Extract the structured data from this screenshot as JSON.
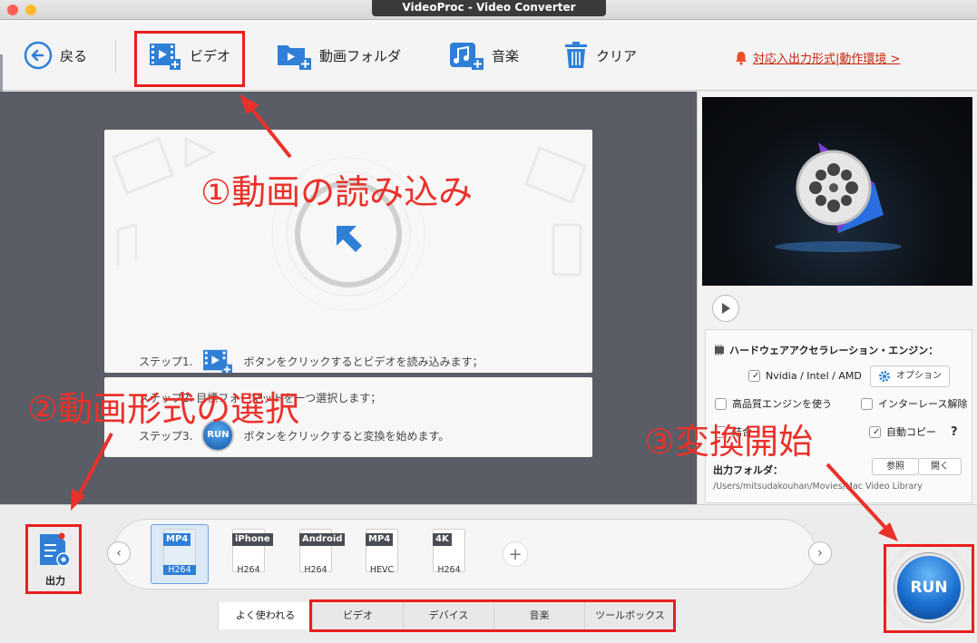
{
  "window": {
    "title": "VideoProc - Video Converter"
  },
  "toolbar": {
    "back_label": "戻る",
    "video_label": "ビデオ",
    "folder_label": "動画フォルダ",
    "music_label": "音楽",
    "clear_label": "クリア",
    "notice_link": "対応入出力形式|動作環境 >"
  },
  "steps": {
    "step1_prefix": "ステップ1.",
    "step1_text": "ボタンをクリックするとビデオを読み込みます；",
    "step2_text": "ステップ2. 目標フォーマットを一つ選択します；",
    "step3_prefix": "ステップ3.",
    "step3_text": "ボタンをクリックすると変換を始めます。",
    "run_small": "RUN"
  },
  "settings": {
    "hw_title": "ハードウェアアクセラレーション・エンジン：",
    "nvidia_label": "Nvidia /  Intel / AMD",
    "option_label": "オプション",
    "hq_engine_label": "高品質エンジンを使う",
    "deinterlace_label": "インターレース解除",
    "merge_label": "結合",
    "autocopy_label": "自動コピー",
    "help_label": "?",
    "output_folder_label": "出力フォルダ：",
    "browse_label": "参照",
    "open_label": "開く",
    "output_path": "/Users/mitsudakouhan/Movies/Mac Video Library"
  },
  "output": {
    "label": "出力"
  },
  "formats": [
    {
      "tag": "MP4",
      "codec": "H264"
    },
    {
      "tag": "iPhone",
      "codec": "H264"
    },
    {
      "tag": "Android",
      "codec": "H264"
    },
    {
      "tag": "MP4",
      "codec": "HEVC"
    },
    {
      "tag": "4K",
      "codec": "H264"
    }
  ],
  "tabs": [
    "よく使われる",
    "ビデオ",
    "デバイス",
    "音楽",
    "ツールボックス"
  ],
  "run_button": "RUN",
  "annotations": {
    "a1": "①動画の読み込み",
    "a2": "②動画形式の選択",
    "a3": "③変換開始"
  },
  "colors": {
    "accent_blue": "#2f7fd6",
    "annotation_red": "#e9312a",
    "notice_red": "#c4260f"
  }
}
